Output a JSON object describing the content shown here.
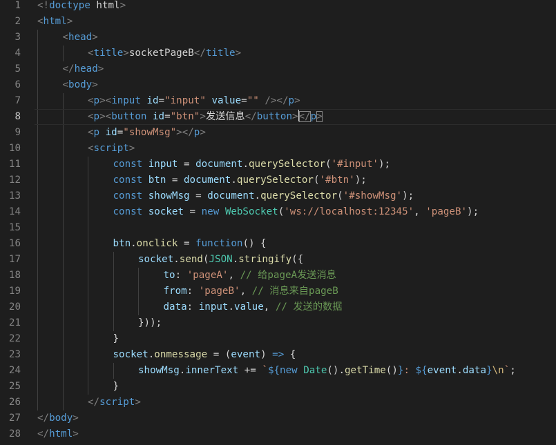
{
  "editor": {
    "current_line": 8,
    "lines": [
      {
        "n": "1",
        "indent": 0,
        "tokens": [
          [
            "br",
            "<!"
          ],
          [
            "tg",
            "doctype"
          ],
          [
            "tx",
            " html"
          ],
          [
            "br",
            ">"
          ]
        ]
      },
      {
        "n": "2",
        "indent": 0,
        "tokens": [
          [
            "br",
            "<"
          ],
          [
            "tg",
            "html"
          ],
          [
            "br",
            ">"
          ]
        ]
      },
      {
        "n": "3",
        "indent": 1,
        "tokens": [
          [
            "br",
            "<"
          ],
          [
            "tg",
            "head"
          ],
          [
            "br",
            ">"
          ]
        ]
      },
      {
        "n": "4",
        "indent": 2,
        "tokens": [
          [
            "br",
            "<"
          ],
          [
            "tg",
            "title"
          ],
          [
            "br",
            ">"
          ],
          [
            "tx",
            "socketPageB"
          ],
          [
            "br",
            "</"
          ],
          [
            "tg",
            "title"
          ],
          [
            "br",
            ">"
          ]
        ]
      },
      {
        "n": "5",
        "indent": 1,
        "tokens": [
          [
            "br",
            "</"
          ],
          [
            "tg",
            "head"
          ],
          [
            "br",
            ">"
          ]
        ]
      },
      {
        "n": "6",
        "indent": 1,
        "tokens": [
          [
            "br",
            "<"
          ],
          [
            "tg",
            "body"
          ],
          [
            "br",
            ">"
          ]
        ]
      },
      {
        "n": "7",
        "indent": 2,
        "tokens": [
          [
            "br",
            "<"
          ],
          [
            "tg",
            "p"
          ],
          [
            "br",
            "><"
          ],
          [
            "tg",
            "input"
          ],
          [
            "tx",
            " "
          ],
          [
            "at",
            "id"
          ],
          [
            "tx",
            "="
          ],
          [
            "st",
            "\"input\""
          ],
          [
            "tx",
            " "
          ],
          [
            "at",
            "value"
          ],
          [
            "tx",
            "="
          ],
          [
            "st",
            "\"\""
          ],
          [
            "tx",
            " "
          ],
          [
            "br",
            "/></"
          ],
          [
            "tg",
            "p"
          ],
          [
            "br",
            ">"
          ]
        ]
      },
      {
        "n": "8",
        "indent": 2,
        "tokens": [
          [
            "br",
            "<"
          ],
          [
            "tg",
            "p"
          ],
          [
            "br",
            "><"
          ],
          [
            "tg",
            "button"
          ],
          [
            "tx",
            " "
          ],
          [
            "at",
            "id"
          ],
          [
            "tx",
            "="
          ],
          [
            "st",
            "\"btn\""
          ],
          [
            "br",
            ">"
          ],
          [
            "tx",
            "发送信息"
          ],
          [
            "br",
            "</"
          ],
          [
            "tg",
            "button"
          ],
          [
            "br",
            ">"
          ],
          [
            "cur",
            ""
          ],
          [
            "bd",
            "</"
          ],
          [
            "tg",
            "p"
          ],
          [
            "bd",
            ">"
          ]
        ]
      },
      {
        "n": "9",
        "indent": 2,
        "tokens": [
          [
            "br",
            "<"
          ],
          [
            "tg",
            "p"
          ],
          [
            "tx",
            " "
          ],
          [
            "at",
            "id"
          ],
          [
            "tx",
            "="
          ],
          [
            "st",
            "\"showMsg\""
          ],
          [
            "br",
            "></"
          ],
          [
            "tg",
            "p"
          ],
          [
            "br",
            ">"
          ]
        ]
      },
      {
        "n": "10",
        "indent": 2,
        "tokens": [
          [
            "br",
            "<"
          ],
          [
            "tg",
            "script"
          ],
          [
            "br",
            ">"
          ]
        ]
      },
      {
        "n": "11",
        "indent": 3,
        "tokens": [
          [
            "tg",
            "const"
          ],
          [
            "tx",
            " "
          ],
          [
            "at",
            "input"
          ],
          [
            "tx",
            " = "
          ],
          [
            "at",
            "document"
          ],
          [
            "tx",
            "."
          ],
          [
            "fn",
            "querySelector"
          ],
          [
            "tx",
            "("
          ],
          [
            "st",
            "'#input'"
          ],
          [
            "tx",
            ");"
          ]
        ]
      },
      {
        "n": "12",
        "indent": 3,
        "tokens": [
          [
            "tg",
            "const"
          ],
          [
            "tx",
            " "
          ],
          [
            "at",
            "btn"
          ],
          [
            "tx",
            " = "
          ],
          [
            "at",
            "document"
          ],
          [
            "tx",
            "."
          ],
          [
            "fn",
            "querySelector"
          ],
          [
            "tx",
            "("
          ],
          [
            "st",
            "'#btn'"
          ],
          [
            "tx",
            ");"
          ]
        ]
      },
      {
        "n": "13",
        "indent": 3,
        "tokens": [
          [
            "tg",
            "const"
          ],
          [
            "tx",
            " "
          ],
          [
            "at",
            "showMsg"
          ],
          [
            "tx",
            " = "
          ],
          [
            "at",
            "document"
          ],
          [
            "tx",
            "."
          ],
          [
            "fn",
            "querySelector"
          ],
          [
            "tx",
            "("
          ],
          [
            "st",
            "'#showMsg'"
          ],
          [
            "tx",
            ");"
          ]
        ]
      },
      {
        "n": "14",
        "indent": 3,
        "tokens": [
          [
            "tg",
            "const"
          ],
          [
            "tx",
            " "
          ],
          [
            "at",
            "socket"
          ],
          [
            "tx",
            " = "
          ],
          [
            "tg",
            "new"
          ],
          [
            "tx",
            " "
          ],
          [
            "cl",
            "WebSocket"
          ],
          [
            "tx",
            "("
          ],
          [
            "st",
            "'ws://localhost:12345'"
          ],
          [
            "tx",
            ", "
          ],
          [
            "st",
            "'pageB'"
          ],
          [
            "tx",
            ");"
          ]
        ]
      },
      {
        "n": "15",
        "indent": 3,
        "tokens": []
      },
      {
        "n": "16",
        "indent": 3,
        "tokens": [
          [
            "at",
            "btn"
          ],
          [
            "tx",
            "."
          ],
          [
            "fn",
            "onclick"
          ],
          [
            "tx",
            " = "
          ],
          [
            "tg",
            "function"
          ],
          [
            "tx",
            "() {"
          ]
        ]
      },
      {
        "n": "17",
        "indent": 4,
        "tokens": [
          [
            "at",
            "socket"
          ],
          [
            "tx",
            "."
          ],
          [
            "fn",
            "send"
          ],
          [
            "tx",
            "("
          ],
          [
            "cl",
            "JSON"
          ],
          [
            "tx",
            "."
          ],
          [
            "fn",
            "stringify"
          ],
          [
            "tx",
            "({"
          ]
        ]
      },
      {
        "n": "18",
        "indent": 5,
        "tokens": [
          [
            "at",
            "to"
          ],
          [
            "tx",
            ": "
          ],
          [
            "st",
            "'pageA'"
          ],
          [
            "tx",
            ", "
          ],
          [
            "cm",
            "// 给pageA发送消息"
          ]
        ]
      },
      {
        "n": "19",
        "indent": 5,
        "tokens": [
          [
            "at",
            "from"
          ],
          [
            "tx",
            ": "
          ],
          [
            "st",
            "'pageB'"
          ],
          [
            "tx",
            ", "
          ],
          [
            "cm",
            "// 消息来自pageB"
          ]
        ]
      },
      {
        "n": "20",
        "indent": 5,
        "tokens": [
          [
            "at",
            "data"
          ],
          [
            "tx",
            ": "
          ],
          [
            "at",
            "input"
          ],
          [
            "tx",
            "."
          ],
          [
            "at",
            "value"
          ],
          [
            "tx",
            ", "
          ],
          [
            "cm",
            "// 发送的数据"
          ]
        ]
      },
      {
        "n": "21",
        "indent": 4,
        "tokens": [
          [
            "tx",
            "}));"
          ]
        ]
      },
      {
        "n": "22",
        "indent": 3,
        "tokens": [
          [
            "tx",
            "}"
          ]
        ]
      },
      {
        "n": "23",
        "indent": 3,
        "tokens": [
          [
            "at",
            "socket"
          ],
          [
            "tx",
            "."
          ],
          [
            "fn",
            "onmessage"
          ],
          [
            "tx",
            " = ("
          ],
          [
            "at",
            "event"
          ],
          [
            "tx",
            ") "
          ],
          [
            "tg",
            "=>"
          ],
          [
            "tx",
            " {"
          ]
        ]
      },
      {
        "n": "24",
        "indent": 4,
        "tokens": [
          [
            "at",
            "showMsg"
          ],
          [
            "tx",
            "."
          ],
          [
            "at",
            "innerText"
          ],
          [
            "tx",
            " += "
          ],
          [
            "st",
            "`"
          ],
          [
            "tg",
            "${"
          ],
          [
            "tg",
            "new"
          ],
          [
            "tx",
            " "
          ],
          [
            "cl",
            "Date"
          ],
          [
            "tx",
            "()."
          ],
          [
            "fn",
            "getTime"
          ],
          [
            "tx",
            "()"
          ],
          [
            "tg",
            "}"
          ],
          [
            "st",
            ": "
          ],
          [
            "tg",
            "${"
          ],
          [
            "at",
            "event"
          ],
          [
            "tx",
            "."
          ],
          [
            "at",
            "data"
          ],
          [
            "tg",
            "}"
          ],
          [
            "es",
            "\\n"
          ],
          [
            "st",
            "`"
          ],
          [
            "tx",
            ";"
          ]
        ]
      },
      {
        "n": "25",
        "indent": 3,
        "tokens": [
          [
            "tx",
            "}"
          ]
        ]
      },
      {
        "n": "26",
        "indent": 2,
        "tokens": [
          [
            "br",
            "</"
          ],
          [
            "tg",
            "script"
          ],
          [
            "br",
            ">"
          ]
        ]
      },
      {
        "n": "27",
        "indent": 0,
        "tokens": [
          [
            "br",
            "</"
          ],
          [
            "tg",
            "body"
          ],
          [
            "br",
            ">"
          ]
        ]
      },
      {
        "n": "28",
        "indent": 0,
        "tokens": [
          [
            "br",
            "</"
          ],
          [
            "tg",
            "html"
          ],
          [
            "br",
            ">"
          ]
        ]
      }
    ]
  }
}
